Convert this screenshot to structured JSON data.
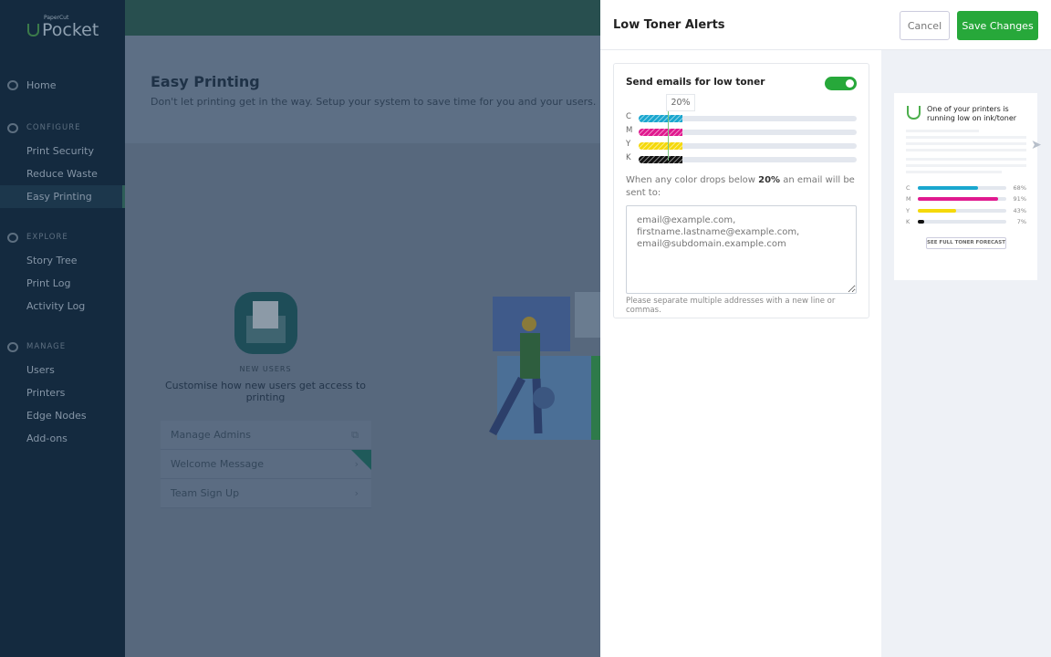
{
  "sidebar": {
    "logo_small": "PaperCut",
    "logo_big": "Pocket",
    "home": "Home",
    "configure": {
      "label": "CONFIGURE",
      "items": [
        "Print Security",
        "Reduce Waste",
        "Easy Printing"
      ]
    },
    "explore": {
      "label": "EXPLORE",
      "items": [
        "Story Tree",
        "Print Log",
        "Activity Log"
      ]
    },
    "manage": {
      "label": "MANAGE",
      "items": [
        "Users",
        "Printers",
        "Edge Nodes",
        "Add-ons"
      ]
    },
    "active": "Easy Printing"
  },
  "page": {
    "title": "Easy Printing",
    "subtitle": "Don't let printing get in the way. Setup your system to save time for you and your users.",
    "new_users": {
      "label": "NEW USERS",
      "desc": "Customise how new users get access to printing",
      "items": [
        "Manage Admins",
        "Welcome Message",
        "Team Sign Up"
      ]
    }
  },
  "panel": {
    "title": "Low Toner Alerts",
    "cancel": "Cancel",
    "save": "Save Changes",
    "toggle_label": "Send emails for low toner",
    "toggle_on": true,
    "threshold_label": "20%",
    "threshold_percent": 20,
    "colors": [
      {
        "key": "C",
        "color": "#1aa7cf"
      },
      {
        "key": "M",
        "color": "#e0198f"
      },
      {
        "key": "Y",
        "color": "#f5d90a"
      },
      {
        "key": "K",
        "color": "#111111"
      }
    ],
    "desc_pre": "When any color drops below ",
    "desc_bold": "20%",
    "desc_post": " an email will be sent to:",
    "email_placeholder": "email@example.com,\nfirstname.lastname@example.com,\nemail@subdomain.example.com",
    "help": "Please separate multiple addresses with a new line or commas."
  },
  "preview": {
    "title": "One of your printers is running low on ink/toner",
    "levels": [
      {
        "key": "C",
        "value": 68,
        "label": "68%",
        "color": "#1aa7cf"
      },
      {
        "key": "M",
        "value": 91,
        "label": "91%",
        "color": "#e0198f"
      },
      {
        "key": "Y",
        "value": 43,
        "label": "43%",
        "color": "#f5d90a"
      },
      {
        "key": "K",
        "value": 7,
        "label": "7%",
        "color": "#111111"
      }
    ],
    "button": "SEE FULL TONER FORECAST"
  }
}
